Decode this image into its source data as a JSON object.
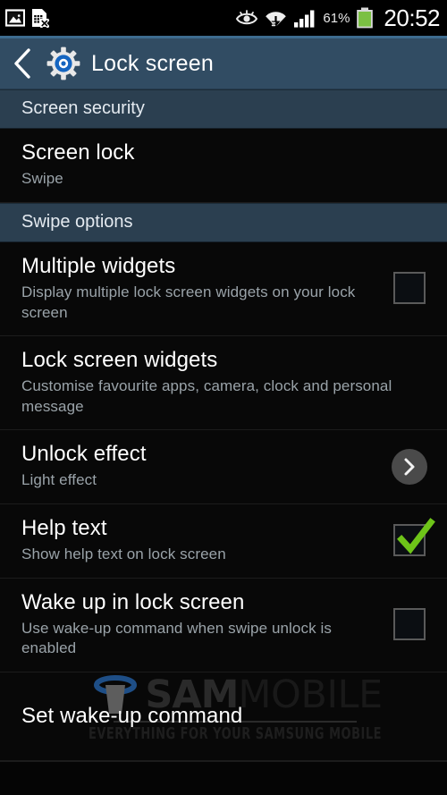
{
  "status_bar": {
    "icons_left": [
      "image-icon",
      "sim-card-x-icon"
    ],
    "icons_right": [
      "smart-stay-eye-icon",
      "wifi-icon",
      "signal-bars-icon"
    ],
    "battery_percent": "61%",
    "clock": "20:52"
  },
  "action_bar": {
    "back_icon": "back-chevron-icon",
    "app_icon": "settings-gear-icon",
    "title": "Lock screen"
  },
  "sections": [
    {
      "header": "Screen security",
      "rows": [
        {
          "title": "Screen lock",
          "subtitle": "Swipe",
          "control": "none"
        }
      ]
    },
    {
      "header": "Swipe options",
      "rows": [
        {
          "title": "Multiple widgets",
          "subtitle": "Display multiple lock screen widgets on your lock screen",
          "control": "checkbox",
          "checked": false
        },
        {
          "title": "Lock screen widgets",
          "subtitle": "Customise favourite apps, camera, clock and personal message",
          "control": "none"
        },
        {
          "title": "Unlock effect",
          "subtitle": "Light effect",
          "control": "chevron"
        },
        {
          "title": "Help text",
          "subtitle": "Show help text on lock screen",
          "control": "checkbox",
          "checked": true
        },
        {
          "title": "Wake up in lock screen",
          "subtitle": "Use wake-up command when swipe unlock is enabled",
          "control": "checkbox",
          "checked": false
        },
        {
          "title": "Set wake-up command",
          "subtitle": "",
          "control": "none"
        }
      ]
    }
  ],
  "watermark": {
    "brand_bold": "SAM",
    "brand_light": "MOBILE",
    "tagline": "EVERYTHING FOR YOUR SAMSUNG MOBILE"
  },
  "colors": {
    "action_bar": "#314c63",
    "section_header": "#2b3f50",
    "row_bg": "#080808",
    "title_text": "#ffffff",
    "sub_text": "#9aa3a9",
    "check_green": "#6ec419",
    "chevron_circle": "#4a4a4a",
    "battery_green": "#7bc043"
  }
}
